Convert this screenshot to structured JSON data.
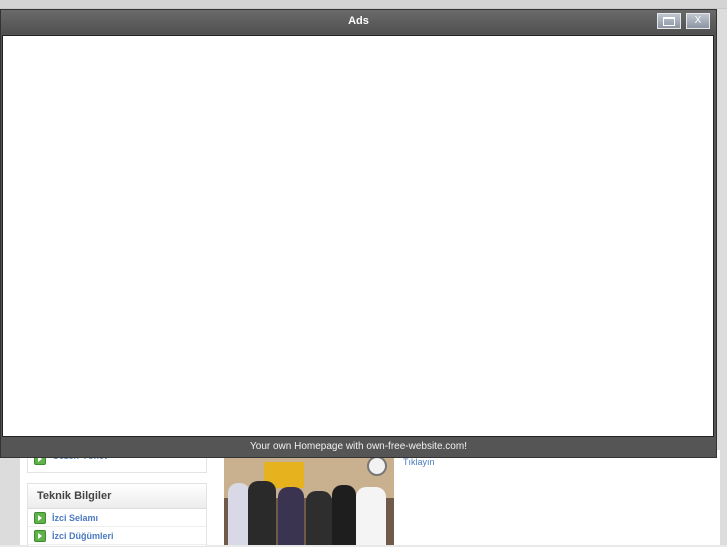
{
  "ads_window": {
    "title": "Ads",
    "footer_text": "Your own Homepage with own-free-website.com!",
    "maximize_label": "",
    "close_label": "X"
  },
  "background_page": {
    "partial_menu_item": "Gezen-Yönet",
    "box_title": "Teknik Bilgiler",
    "links": [
      "İzci Selamı",
      "İzci Düğümleri"
    ],
    "right_link": "Tıklayın"
  },
  "colors": {
    "titlebar": "#555555",
    "link": "#4a7ac2",
    "arrow_icon": "#5fb24a"
  }
}
